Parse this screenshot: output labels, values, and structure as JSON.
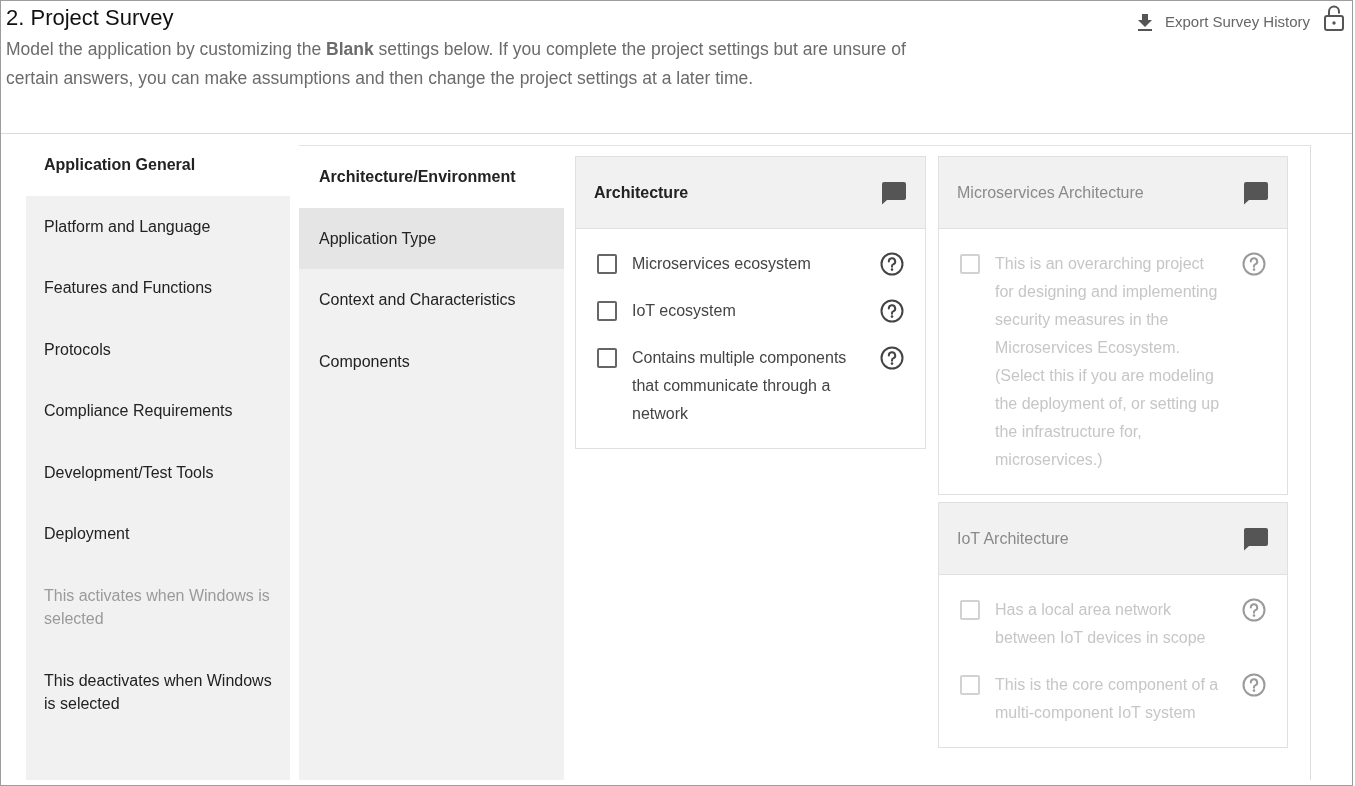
{
  "header": {
    "title": "2. Project Survey",
    "description": "Model the application by customizing the **Blank** settings below. If you complete the project settings but are unsure of certain answers, you can make assumptions and then change the project settings at a later time.",
    "export_link": "Export Survey History"
  },
  "sections": [
    {
      "label": "Application General",
      "selected": true,
      "disabled": false
    },
    {
      "label": "Platform and Language",
      "selected": false,
      "disabled": false
    },
    {
      "label": "Features and Functions",
      "selected": false,
      "disabled": false
    },
    {
      "label": "Protocols",
      "selected": false,
      "disabled": false
    },
    {
      "label": "Compliance Requirements",
      "selected": false,
      "disabled": false
    },
    {
      "label": "Development/Test Tools",
      "selected": false,
      "disabled": false
    },
    {
      "label": "Deployment",
      "selected": false,
      "disabled": false
    },
    {
      "label": "This activates when Windows is selected",
      "selected": false,
      "disabled": true
    },
    {
      "label": "This deactivates when Windows is selected",
      "selected": false,
      "disabled": false
    }
  ],
  "subsections": [
    {
      "label": "Architecture/Environment",
      "selected": true,
      "highlighted": false
    },
    {
      "label": "Application Type",
      "selected": false,
      "highlighted": true
    },
    {
      "label": "Context and Characteristics",
      "selected": false,
      "highlighted": false
    },
    {
      "label": "Components",
      "selected": false,
      "highlighted": false
    }
  ],
  "question_columns": [
    {
      "groups": [
        {
          "title": "Architecture",
          "disabled": false,
          "options": [
            {
              "label": "Microservices ecosystem",
              "checked": false
            },
            {
              "label": "IoT ecosystem",
              "checked": false
            },
            {
              "label": "Contains multiple components that communicate through a network",
              "checked": false
            }
          ]
        }
      ]
    },
    {
      "groups": [
        {
          "title": "Microservices Architecture",
          "disabled": true,
          "options": [
            {
              "label": "This is an overarching project for designing and implementing security measures in the Microservices Ecosystem. (Select this if you are modeling the deployment of, or setting up the infrastructure for, microservices.)",
              "checked": false
            }
          ]
        },
        {
          "title": "IoT Architecture",
          "disabled": true,
          "options": [
            {
              "label": "Has a local area network between IoT devices in scope",
              "checked": false
            },
            {
              "label": "This is the core component of a multi-component IoT system",
              "checked": false
            }
          ]
        }
      ]
    }
  ]
}
